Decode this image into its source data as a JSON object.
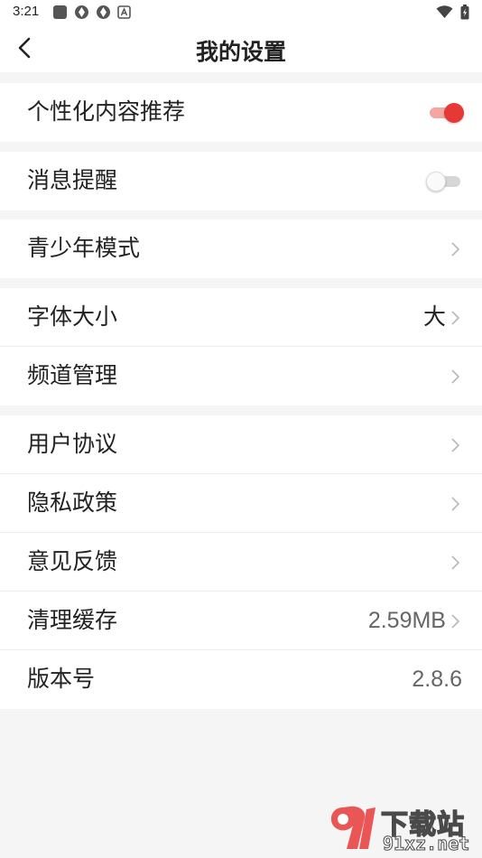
{
  "status_bar": {
    "time": "3:21"
  },
  "header": {
    "title": "我的设置"
  },
  "settings": {
    "personalized": {
      "label": "个性化内容推荐",
      "enabled": true
    },
    "notifications": {
      "label": "消息提醒",
      "enabled": false
    },
    "teen_mode": {
      "label": "青少年模式"
    },
    "font_size": {
      "label": "字体大小",
      "value": "大"
    },
    "channel": {
      "label": "频道管理"
    },
    "user_agreement": {
      "label": "用户协议"
    },
    "privacy": {
      "label": "隐私政策"
    },
    "feedback": {
      "label": "意见反馈"
    },
    "cache": {
      "label": "清理缓存",
      "value": "2.59MB"
    },
    "version": {
      "label": "版本号",
      "value": "2.8.6"
    }
  },
  "watermark": {
    "brand": "下载站",
    "domain": "91xz.net"
  },
  "colors": {
    "accent": "#e53935",
    "background": "#f5f5f5",
    "surface": "#ffffff"
  }
}
